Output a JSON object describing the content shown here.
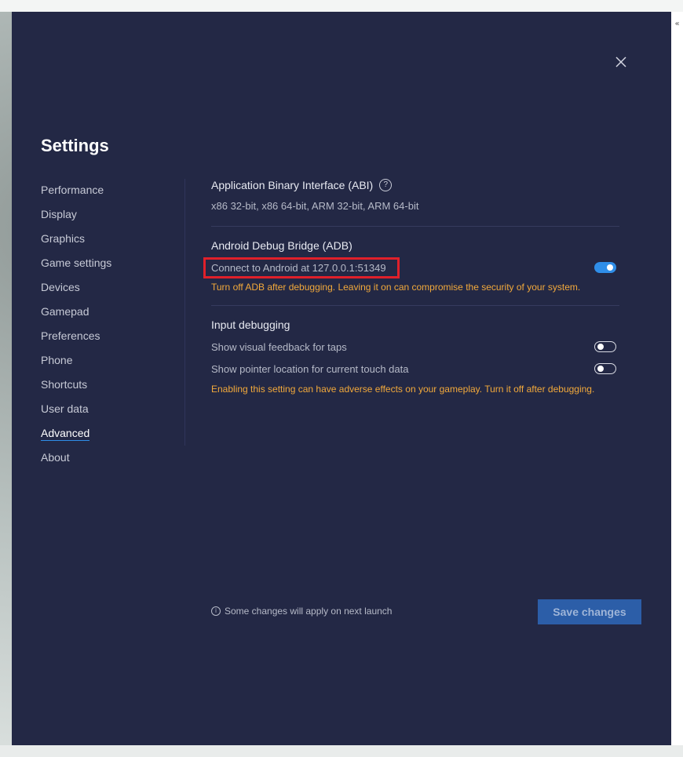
{
  "dialog": {
    "title": "Settings",
    "close_icon": "close-icon"
  },
  "sidebar": {
    "items": [
      {
        "label": "Performance",
        "active": false
      },
      {
        "label": "Display",
        "active": false
      },
      {
        "label": "Graphics",
        "active": false
      },
      {
        "label": "Game settings",
        "active": false
      },
      {
        "label": "Devices",
        "active": false
      },
      {
        "label": "Gamepad",
        "active": false
      },
      {
        "label": "Preferences",
        "active": false
      },
      {
        "label": "Phone",
        "active": false
      },
      {
        "label": "Shortcuts",
        "active": false
      },
      {
        "label": "User data",
        "active": false
      },
      {
        "label": "Advanced",
        "active": true
      },
      {
        "label": "About",
        "active": false
      }
    ]
  },
  "abi": {
    "title": "Application Binary Interface (ABI)",
    "help_icon": "question-circle-icon",
    "value": "x86 32-bit, x86 64-bit, ARM 32-bit, ARM 64-bit"
  },
  "adb": {
    "title": "Android Debug Bridge (ADB)",
    "connect_label": "Connect to Android at 127.0.0.1:51349",
    "connect_enabled": true,
    "warning": "Turn off ADB after debugging. Leaving it on can compromise the security of your system."
  },
  "input_debugging": {
    "title": "Input debugging",
    "options": [
      {
        "label": "Show visual feedback for taps",
        "enabled": false
      },
      {
        "label": "Show pointer location for current touch data",
        "enabled": false
      }
    ],
    "warning": "Enabling this setting can have adverse effects on your gameplay. Turn it off after debugging."
  },
  "footer": {
    "info_icon": "info-circle-icon",
    "note": "Some changes will apply on next launch",
    "save_label": "Save changes"
  },
  "colors": {
    "dialog_bg": "#232845",
    "accent": "#2f8ee8",
    "warning": "#f2a93b",
    "highlight_box": "#e0202a",
    "save_button_bg": "#2c5ea8"
  }
}
